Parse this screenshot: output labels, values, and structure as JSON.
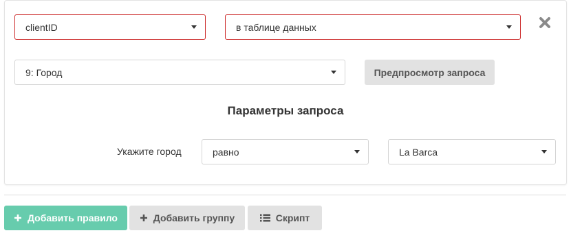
{
  "filter": {
    "field_select": "clientID",
    "source_select": "в таблице данных",
    "column_select": "9: Город",
    "preview_button": "Предпросмотр запроса"
  },
  "params": {
    "title": "Параметры запроса",
    "city_label": "Укажите город",
    "operator_select": "равно",
    "value_select": "La Barca"
  },
  "actions": {
    "add_rule": "Добавить правило",
    "add_group": "Добавить группу",
    "script": "Скрипт"
  },
  "icons": {
    "close": "close-icon",
    "add_rule": "plus-icon",
    "add_group": "plus-icon",
    "script": "list-icon"
  },
  "colors": {
    "invalid_border": "#cc2b2b",
    "primary_green": "#67ccad",
    "secondary_gray": "#e2e2e2"
  }
}
